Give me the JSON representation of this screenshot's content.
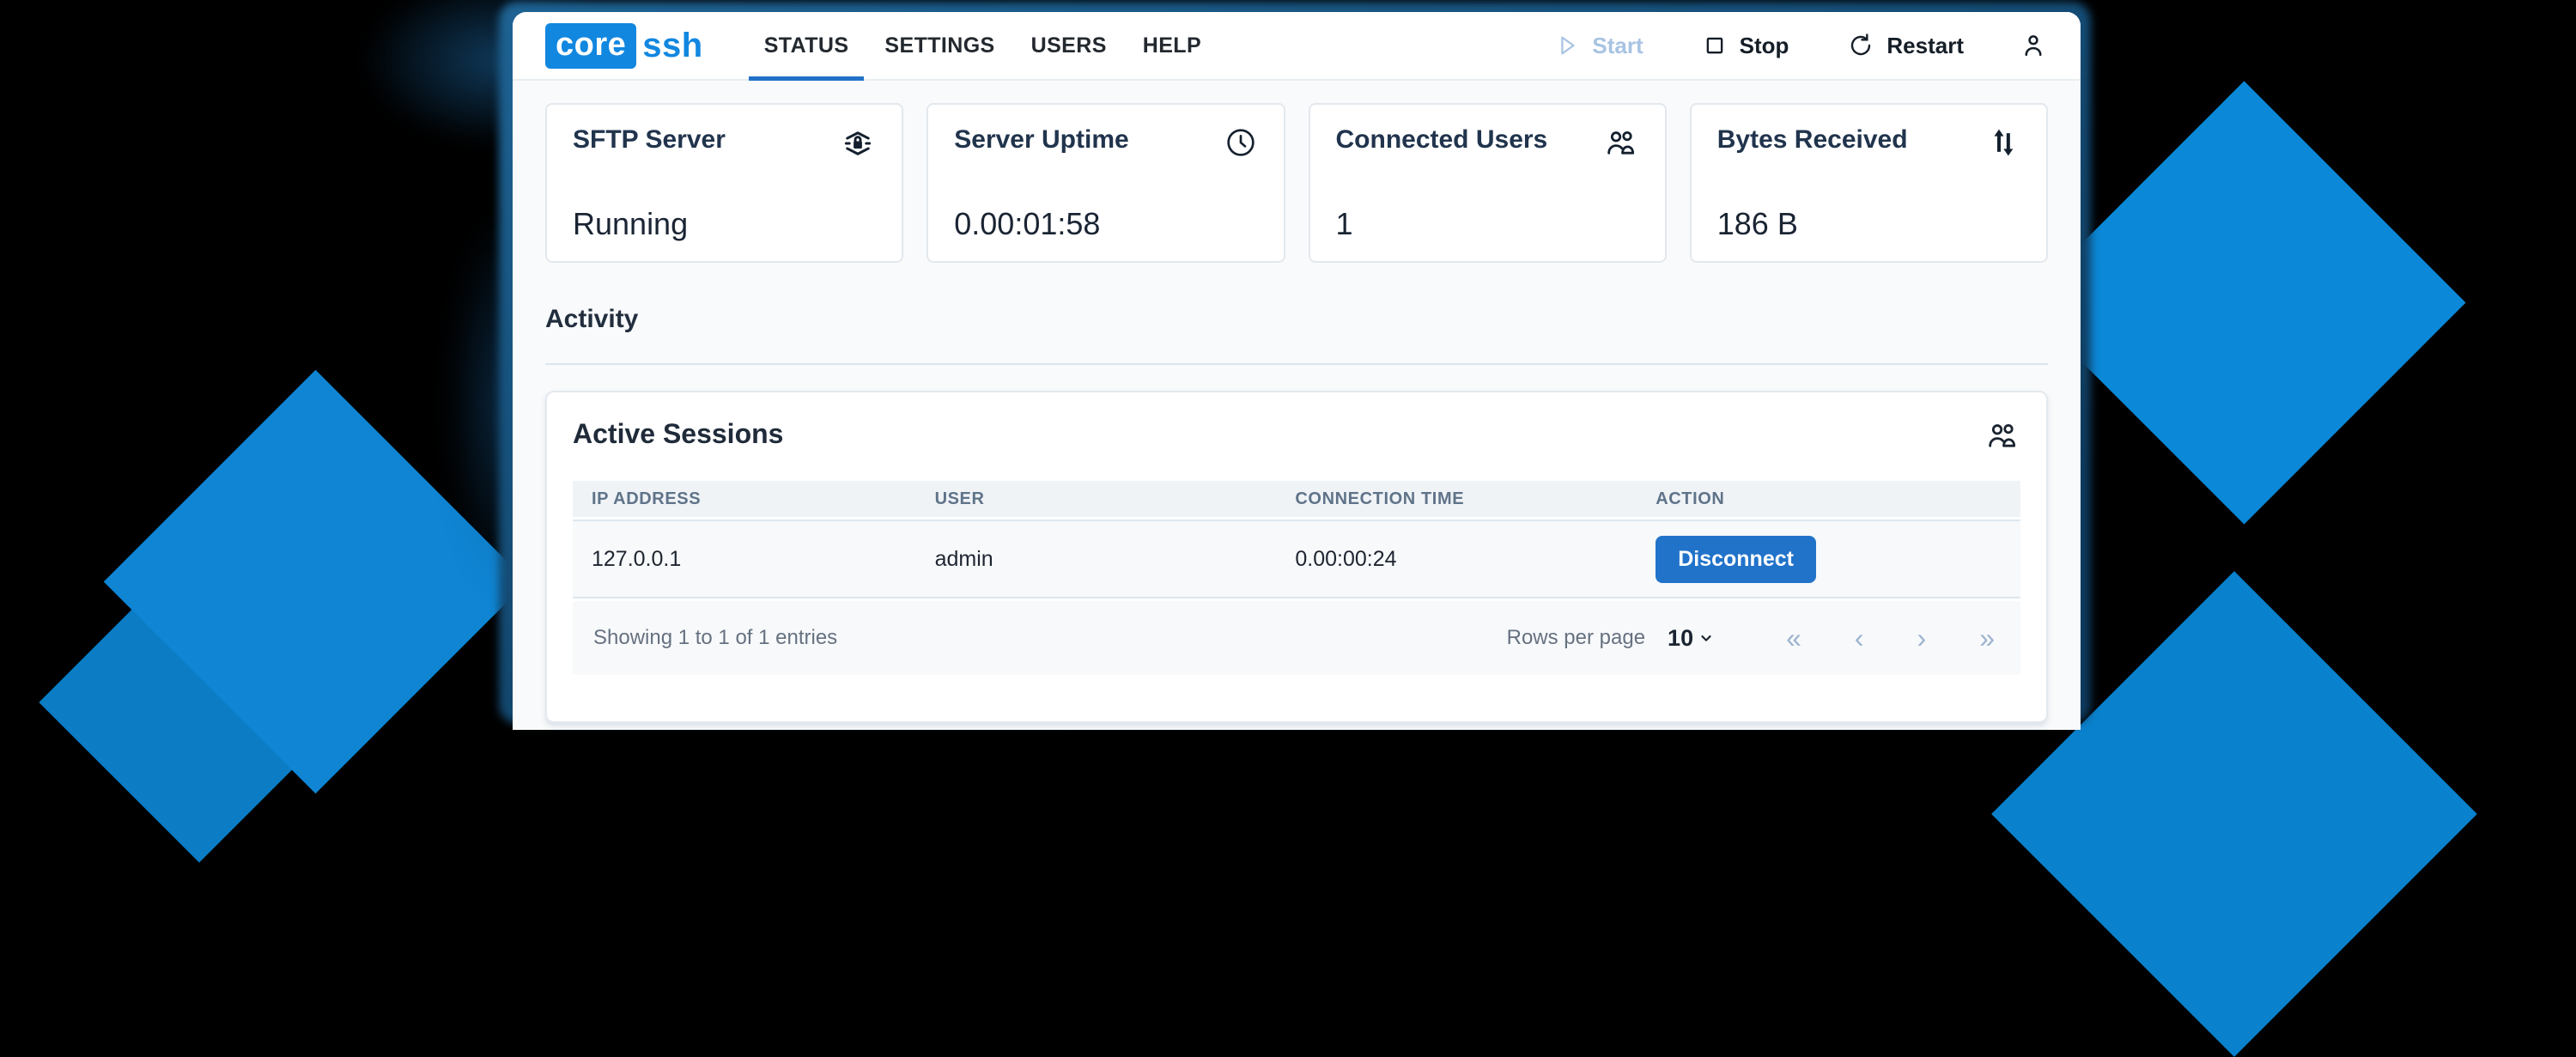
{
  "brand": {
    "core": "core",
    "ssh": "ssh"
  },
  "nav": {
    "tabs": [
      {
        "label": "STATUS",
        "active": true
      },
      {
        "label": "SETTINGS",
        "active": false
      },
      {
        "label": "USERS",
        "active": false
      },
      {
        "label": "HELP",
        "active": false
      }
    ]
  },
  "controls": {
    "start": {
      "label": "Start",
      "enabled": false,
      "icon": "play-icon"
    },
    "stop": {
      "label": "Stop",
      "enabled": true,
      "icon": "stop-icon"
    },
    "restart": {
      "label": "Restart",
      "enabled": true,
      "icon": "restart-icon"
    },
    "user": {
      "icon": "person-icon"
    }
  },
  "cards": [
    {
      "title": "SFTP Server",
      "icon": "secure-layers-icon",
      "value": "Running"
    },
    {
      "title": "Server Uptime",
      "icon": "clock-icon",
      "value": "0.00:01:58"
    },
    {
      "title": "Connected Users",
      "icon": "people-icon",
      "value": "1"
    },
    {
      "title": "Bytes Received",
      "icon": "arrows-up-down-icon",
      "value": "186 B"
    }
  ],
  "activity": {
    "heading": "Activity"
  },
  "sessions": {
    "title": "Active Sessions",
    "icon": "people-icon",
    "columns": [
      "IP ADDRESS",
      "USER",
      "CONNECTION TIME",
      "ACTION"
    ],
    "rows": [
      {
        "ip": "127.0.0.1",
        "user": "admin",
        "time": "0.00:00:24",
        "action": "Disconnect"
      }
    ],
    "footer": {
      "summary": "Showing 1 to 1 of 1 entries",
      "rows_per_page_label": "Rows per page",
      "rows_per_page_value": "10",
      "pagination": [
        "«",
        "‹",
        "›",
        "»"
      ]
    }
  },
  "colors": {
    "brand_blue": "#1287e0",
    "tab_underline": "#2271c6",
    "button_blue": "#2173ca",
    "diamond_blue": "#0d86d4",
    "page_background": "#f8fafb",
    "window_glow": "#16517c"
  }
}
